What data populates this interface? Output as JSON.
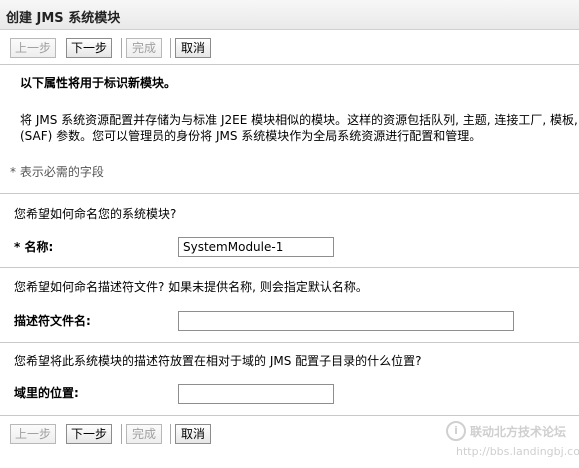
{
  "header": {
    "title": "创建 JMS 系统模块"
  },
  "buttons": {
    "back": "上一步",
    "next": "下一步",
    "finish": "完成",
    "cancel": "取消"
  },
  "intro": {
    "heading": "以下属性将用于标识新模块。",
    "line1": "将 JMS 系统资源配置并存储为与标准 J2EE 模块相似的模块。这样的资源包括队列, 主题, 连接工厂, 模板,",
    "line2": "(SAF) 参数。您可以管理员的身份将 JMS 系统模块作为全局系统资源进行配置和管理。"
  },
  "required_note": "* 表示必需的字段",
  "section_name": {
    "question": "您希望如何命名您的系统模块?",
    "required_mark": "*",
    "label": "名称:",
    "value": "SystemModule-1"
  },
  "section_descriptor": {
    "question": "您希望如何命名描述符文件? 如果未提供名称, 则会指定默认名称。",
    "label": "描述符文件名:",
    "value": ""
  },
  "section_location": {
    "question": "您希望将此系统模块的描述符放置在相对于域的 JMS 配置子目录的什么位置?",
    "label": "域里的位置:",
    "value": ""
  },
  "watermark": {
    "text": "联动北方技术论坛",
    "url": "http://bbs.landingbj.com"
  }
}
